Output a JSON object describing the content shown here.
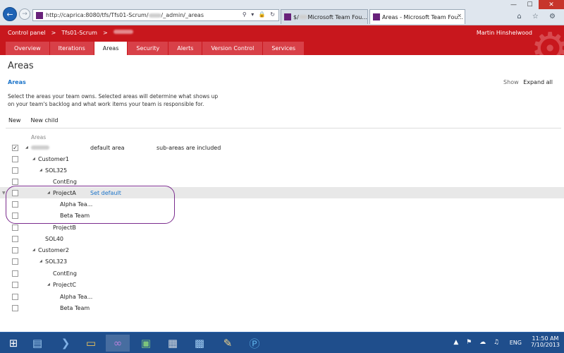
{
  "browser": {
    "url": "http://caprica:8080/tfs/Tfs01-Scrum/",
    "url_tail": "/_admin/_areas",
    "tabs": [
      {
        "label": "Microsoft Team Fou...",
        "prefix": "$/"
      },
      {
        "label": "Areas - Microsoft Team Fou..."
      }
    ],
    "window_controls": [
      "—",
      "☐",
      "✕"
    ],
    "right_icons": "⌂ ☆ ⚙"
  },
  "header": {
    "breadcrumb": [
      "Control panel",
      ">",
      "Tfs01-Scrum",
      ">"
    ],
    "user": "Martin Hinshelwood",
    "tabs": [
      "Overview",
      "Iterations",
      "Areas",
      "Security",
      "Alerts",
      "Version Control",
      "Services"
    ],
    "active_tab": "Areas"
  },
  "content": {
    "title": "Areas",
    "subtitle": "Areas",
    "show_label": "Show",
    "expand_all": "Expand all",
    "description": "Select the areas your team owns. Selected areas will determine what shows up on your team's backlog and what work items your team is responsible for.",
    "toolbar": {
      "new": "New",
      "new_child": "New child"
    },
    "column_header": "Areas",
    "rows": [
      {
        "name": "",
        "checked": true,
        "default": "default area",
        "sub": "sub-areas are included"
      },
      {
        "name": "Customer1"
      },
      {
        "name": "SOL325"
      },
      {
        "name": "ContEng"
      },
      {
        "name": "ProjectA",
        "action": "Set default"
      },
      {
        "name": "Alpha Tea..."
      },
      {
        "name": "Beta Team"
      },
      {
        "name": "ProjectB"
      },
      {
        "name": "SOL40"
      },
      {
        "name": "Customer2"
      },
      {
        "name": "SOL323"
      },
      {
        "name": "ContEng"
      },
      {
        "name": "ProjectC"
      },
      {
        "name": "Alpha Tea..."
      },
      {
        "name": "Beta Team"
      }
    ]
  },
  "taskbar": {
    "icons": [
      "windows-start-icon",
      "server-manager-icon",
      "powershell-icon",
      "file-explorer-icon",
      "visual-studio-icon",
      "package-icon",
      "buildings-icon",
      "remote-desktop-icon",
      "notepad-icon",
      "internet-explorer-icon"
    ],
    "language": "ENG",
    "time": "11:50 AM",
    "date": "7/10/2013"
  }
}
